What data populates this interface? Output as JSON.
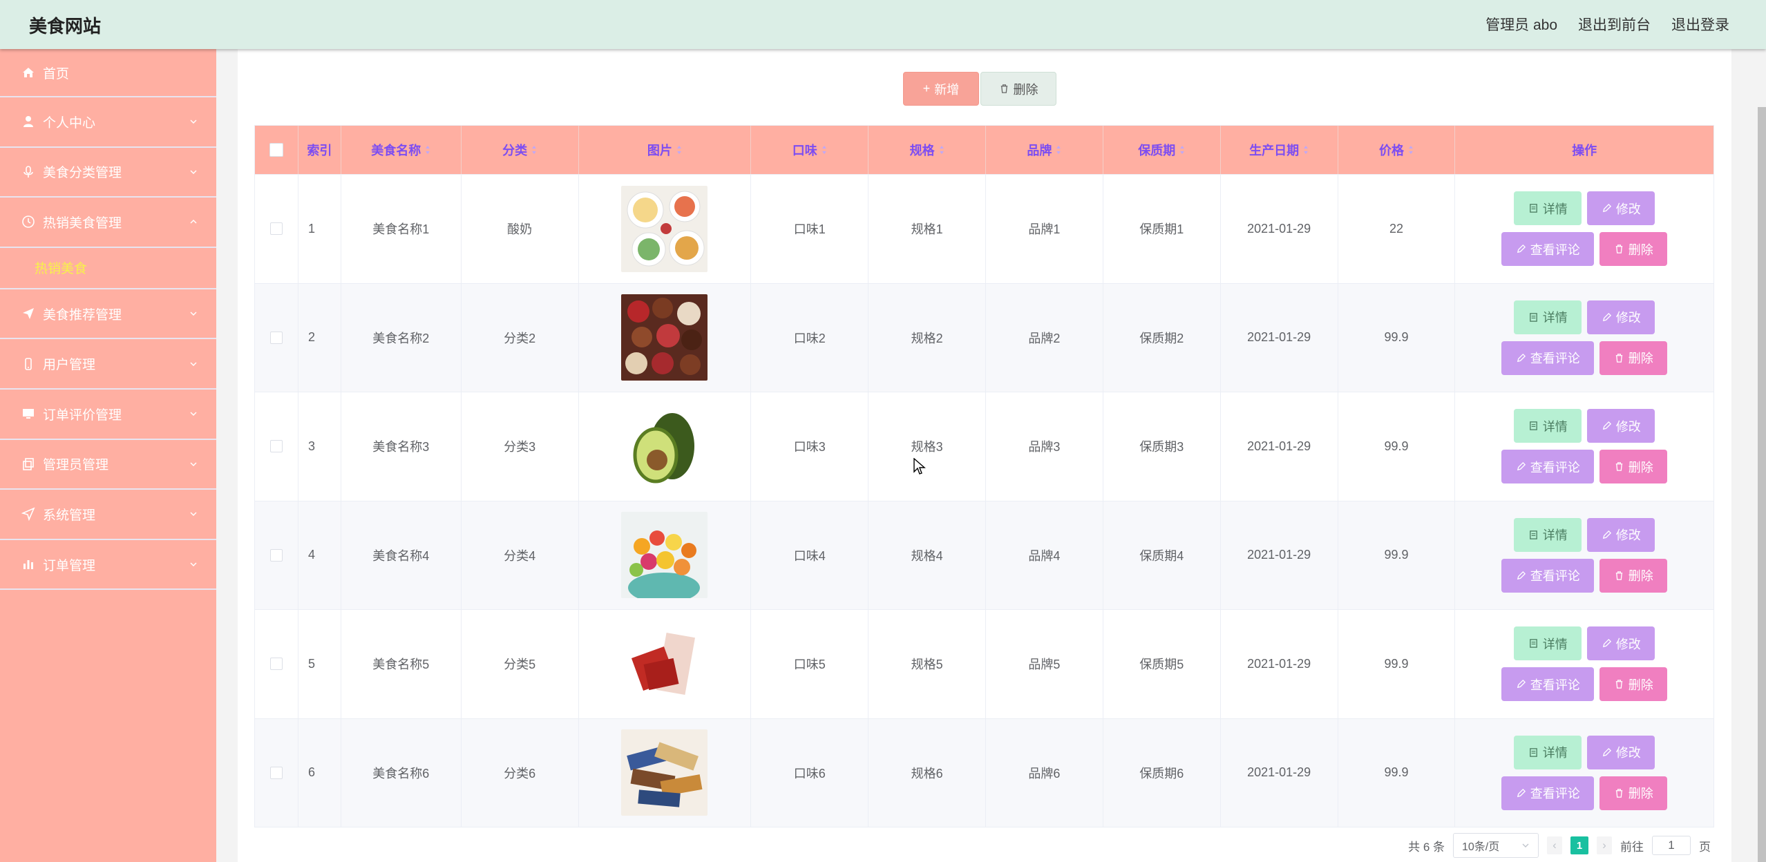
{
  "app": {
    "title": "美食网站"
  },
  "header": {
    "user": "管理员 abo",
    "front": "退出到前台",
    "logout": "退出登录"
  },
  "sidebar": {
    "items": [
      {
        "label": "首页",
        "icon": "home-icon"
      },
      {
        "label": "个人中心",
        "icon": "user-icon"
      },
      {
        "label": "美食分类管理",
        "icon": "mic-icon"
      },
      {
        "label": "热销美食管理",
        "icon": "clock-icon",
        "expanded": true
      },
      {
        "label": "美食推荐管理",
        "icon": "send-icon"
      },
      {
        "label": "用户管理",
        "icon": "phone-icon"
      },
      {
        "label": "订单评价管理",
        "icon": "monitor-icon"
      },
      {
        "label": "管理员管理",
        "icon": "copy-icon"
      },
      {
        "label": "系统管理",
        "icon": "navigation-icon"
      },
      {
        "label": "订单管理",
        "icon": "bar-chart-icon"
      }
    ],
    "submenu": "热销美食"
  },
  "toolbar": {
    "add": "新增",
    "delete": "删除"
  },
  "table": {
    "headers": [
      "索引",
      "美食名称",
      "分类",
      "图片",
      "口味",
      "规格",
      "品牌",
      "保质期",
      "生产日期",
      "价格",
      "操作"
    ],
    "rows": [
      {
        "index": "1",
        "name": "美食名称1",
        "category": "酸奶",
        "image": "yogurt-bowls-photo",
        "flavor": "口味1",
        "spec": "规格1",
        "brand": "品牌1",
        "shelf": "保质期1",
        "date": "2021-01-29",
        "price": "22"
      },
      {
        "index": "2",
        "name": "美食名称2",
        "category": "分类2",
        "image": "chocolates-photo",
        "flavor": "口味2",
        "spec": "规格2",
        "brand": "品牌2",
        "shelf": "保质期2",
        "date": "2021-01-29",
        "price": "99.9"
      },
      {
        "index": "3",
        "name": "美食名称3",
        "category": "分类3",
        "image": "avocado-photo",
        "flavor": "口味3",
        "spec": "规格3",
        "brand": "品牌3",
        "shelf": "保质期3",
        "date": "2021-01-29",
        "price": "99.9"
      },
      {
        "index": "4",
        "name": "美食名称4",
        "category": "分类4",
        "image": "candies-photo",
        "flavor": "口味4",
        "spec": "规格4",
        "brand": "品牌4",
        "shelf": "保质期4",
        "date": "2021-01-29",
        "price": "99.9"
      },
      {
        "index": "5",
        "name": "美食名称5",
        "category": "分类5",
        "image": "jerky-photo",
        "flavor": "口味5",
        "spec": "规格5",
        "brand": "品牌5",
        "shelf": "保质期5",
        "date": "2021-01-29",
        "price": "99.9"
      },
      {
        "index": "6",
        "name": "美食名称6",
        "category": "分类6",
        "image": "snack-bars-photo",
        "flavor": "口味6",
        "spec": "规格6",
        "brand": "品牌6",
        "shelf": "保质期6",
        "date": "2021-01-29",
        "price": "99.9"
      }
    ],
    "ops": {
      "detail": "详情",
      "edit": "修改",
      "review": "查看评论",
      "delete": "删除"
    }
  },
  "pagination": {
    "total": "共 6 条",
    "page_size": "10条/页",
    "current": "1",
    "goto_label": "前往",
    "goto_value": "1",
    "page_suffix": "页"
  },
  "colors": {
    "header_bg": "#dbeee6",
    "sidebar_bg": "#ffafa2",
    "table_head_bg": "#ffafa2",
    "header_text": "#7c4df2",
    "submenu_text": "#f7f24a",
    "pager_active": "#19c0a0"
  }
}
